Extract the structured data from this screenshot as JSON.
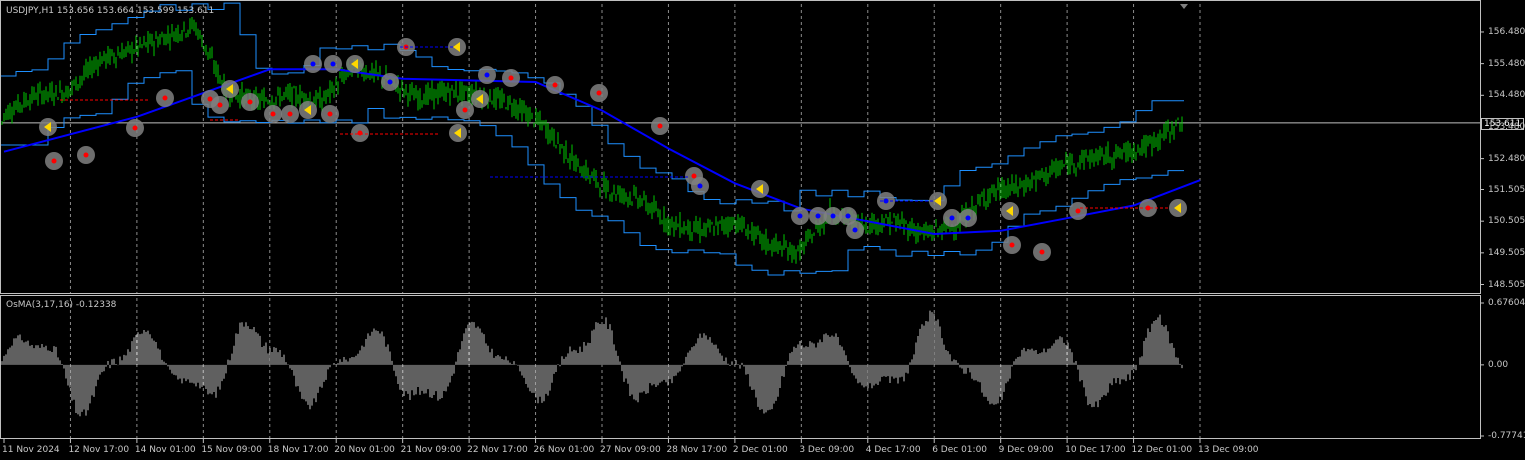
{
  "main_panel": {
    "symbol_info": "USDJPY,H1  153.656 153.664 153.599 153.611",
    "current_price_label": "153.611",
    "price_axis": [
      "156.480",
      "155.480",
      "154.480",
      "153.480",
      "152.480",
      "151.505",
      "150.505",
      "149.505",
      "148.505"
    ]
  },
  "sub_panel": {
    "indicator_label": "OsMA(3,17,16) -0.12338",
    "value_axis": [
      "0.67604",
      "0.00",
      "-0.77741"
    ]
  },
  "time_axis": [
    "11 Nov 2024",
    "12 Nov 17:00",
    "14 Nov 01:00",
    "15 Nov 09:00",
    "18 Nov 17:00",
    "20 Nov 01:00",
    "21 Nov 09:00",
    "22 Nov 17:00",
    "26 Nov 01:00",
    "27 Nov 09:00",
    "28 Nov 17:00",
    "2 Dec 01:00",
    "3 Dec 09:00",
    "4 Dec 17:00",
    "6 Dec 01:00",
    "9 Dec 09:00",
    "10 Dec 17:00",
    "12 Dec 01:00",
    "13 Dec 09:00"
  ],
  "colors": {
    "background": "#000000",
    "candles": "#00c800",
    "moving_average": "#0000ff",
    "channel": "#1e90ff",
    "osma_histogram": "#c0c0c0",
    "grid": "#ffffff",
    "axis_text": "#c8c8c8",
    "signal_red": "#ff0000",
    "signal_yellow": "#ffd700",
    "signal_blue": "#0000ff",
    "signal_circle": "#808080"
  },
  "chart_data": {
    "type": "candlestick",
    "symbol": "USDJPY",
    "timeframe": "H1",
    "last": {
      "open": 153.656,
      "high": 153.664,
      "low": 153.599,
      "close": 153.611
    },
    "ylim": [
      148.3,
      157.3
    ],
    "price_series": [
      {
        "x": "11 Nov 2024",
        "y": 153.9
      },
      {
        "x": "12 Nov 05:00",
        "y": 154.5
      },
      {
        "x": "12 Nov 17:00",
        "y": 154.6
      },
      {
        "x": "13 Nov 09:00",
        "y": 155.6
      },
      {
        "x": "14 Nov 01:00",
        "y": 155.9
      },
      {
        "x": "14 Nov 13:00",
        "y": 156.3
      },
      {
        "x": "15 Nov 00:00",
        "y": 156.7
      },
      {
        "x": "15 Nov 09:00",
        "y": 154.6
      },
      {
        "x": "18 Nov 05:00",
        "y": 154.3
      },
      {
        "x": "18 Nov 17:00",
        "y": 154.5
      },
      {
        "x": "19 Nov 09:00",
        "y": 154.3
      },
      {
        "x": "20 Nov 01:00",
        "y": 155.4
      },
      {
        "x": "20 Nov 17:00",
        "y": 155.0
      },
      {
        "x": "21 Nov 09:00",
        "y": 154.4
      },
      {
        "x": "22 Nov 01:00",
        "y": 154.6
      },
      {
        "x": "22 Nov 17:00",
        "y": 154.5
      },
      {
        "x": "25 Nov 09:00",
        "y": 154.2
      },
      {
        "x": "26 Nov 01:00",
        "y": 153.5
      },
      {
        "x": "26 Nov 17:00",
        "y": 152.3
      },
      {
        "x": "27 Nov 09:00",
        "y": 151.5
      },
      {
        "x": "28 Nov 01:00",
        "y": 151.2
      },
      {
        "x": "28 Nov 17:00",
        "y": 150.4
      },
      {
        "x": "29 Nov 09:00",
        "y": 150.2
      },
      {
        "x": "2 Dec 01:00",
        "y": 150.5
      },
      {
        "x": "2 Dec 17:00",
        "y": 149.8
      },
      {
        "x": "3 Dec 09:00",
        "y": 149.5
      },
      {
        "x": "3 Dec 21:00",
        "y": 150.8
      },
      {
        "x": "4 Dec 17:00",
        "y": 150.4
      },
      {
        "x": "5 Dec 09:00",
        "y": 150.5
      },
      {
        "x": "6 Dec 01:00",
        "y": 150.1
      },
      {
        "x": "6 Dec 17:00",
        "y": 150.4
      },
      {
        "x": "9 Dec 09:00",
        "y": 151.4
      },
      {
        "x": "10 Dec 01:00",
        "y": 151.6
      },
      {
        "x": "10 Dec 17:00",
        "y": 152.1
      },
      {
        "x": "11 Dec 09:00",
        "y": 152.5
      },
      {
        "x": "12 Dec 01:00",
        "y": 152.6
      },
      {
        "x": "12 Dec 17:00",
        "y": 152.9
      },
      {
        "x": "13 Dec 09:00",
        "y": 153.611
      }
    ],
    "moving_average": [
      {
        "x": "11 Nov 2024",
        "y": 152.7
      },
      {
        "x": "14 Nov 01:00",
        "y": 153.8
      },
      {
        "x": "18 Nov 17:00",
        "y": 155.3
      },
      {
        "x": "20 Nov 01:00",
        "y": 155.3
      },
      {
        "x": "21 Nov 09:00",
        "y": 155.0
      },
      {
        "x": "26 Nov 01:00",
        "y": 154.9
      },
      {
        "x": "27 Nov 09:00",
        "y": 154.0
      },
      {
        "x": "28 Nov 17:00",
        "y": 152.8
      },
      {
        "x": "2 Dec 01:00",
        "y": 151.7
      },
      {
        "x": "3 Dec 09:00",
        "y": 150.9
      },
      {
        "x": "4 Dec 17:00",
        "y": 150.5
      },
      {
        "x": "6 Dec 01:00",
        "y": 150.1
      },
      {
        "x": "9 Dec 09:00",
        "y": 150.2
      },
      {
        "x": "10 Dec 17:00",
        "y": 150.6
      },
      {
        "x": "12 Dec 01:00",
        "y": 151.0
      },
      {
        "x": "13 Dec 09:00",
        "y": 151.8
      }
    ],
    "osma": {
      "name": "OsMA(3,17,16)",
      "last_value": -0.12338,
      "ylim": [
        -0.77741,
        0.67604
      ]
    }
  }
}
